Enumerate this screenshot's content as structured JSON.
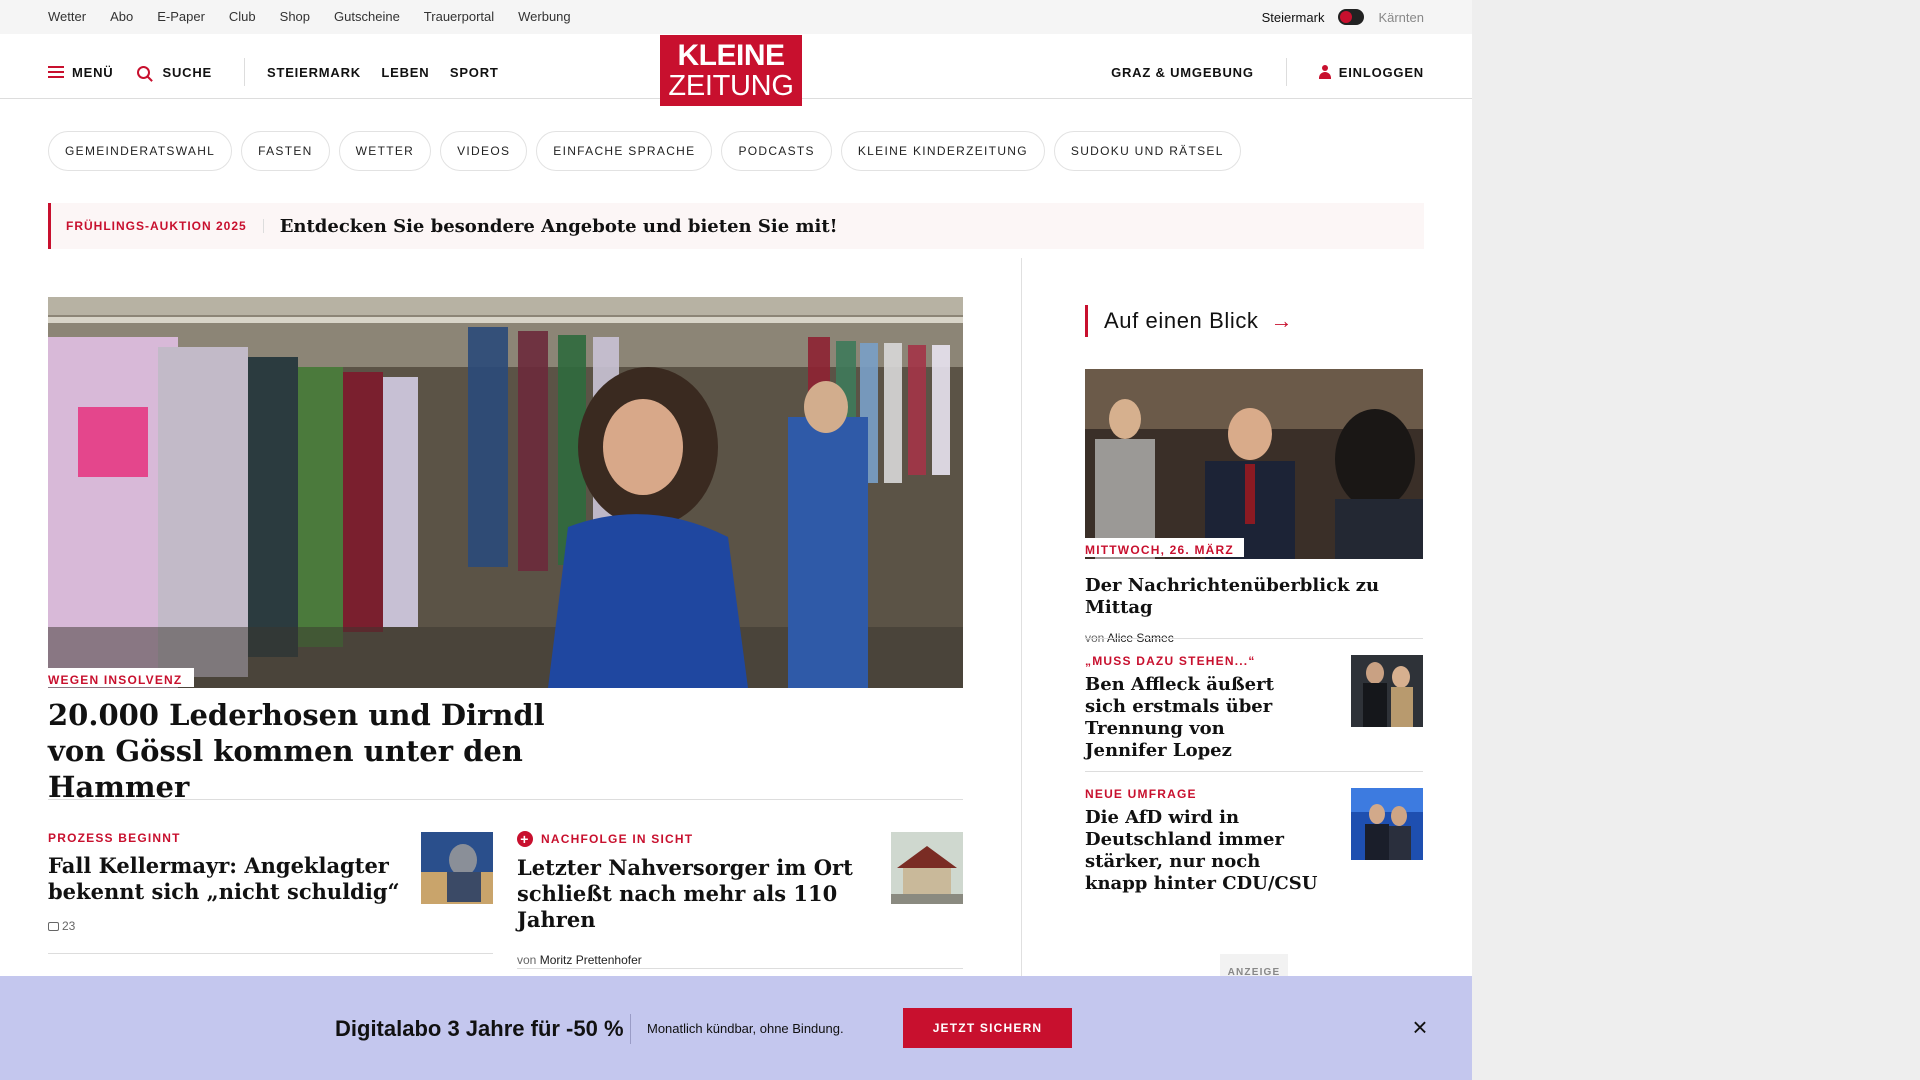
{
  "utility": {
    "links": [
      "Wetter",
      "Abo",
      "E-Paper",
      "Club",
      "Shop",
      "Gutscheine",
      "Trauerportal",
      "Werbung"
    ],
    "region_left": "Steiermark",
    "region_right": "Kärnten"
  },
  "header": {
    "menu_label": "MENÜ",
    "search_label": "SUCHE",
    "nav": [
      "STEIERMARK",
      "LEBEN",
      "SPORT"
    ],
    "logo_line1": "KLEINE",
    "logo_line2": "ZEITUNG",
    "local_label": "GRAZ & UMGEBUNG",
    "login_label": "EINLOGGEN"
  },
  "topics": [
    "GEMEINDERATSWAHL",
    "FASTEN",
    "WETTER",
    "VIDEOS",
    "EINFACHE SPRACHE",
    "PODCASTS",
    "KLEINE KINDERZEITUNG",
    "SUDOKU UND RÄTSEL"
  ],
  "promo": {
    "kicker": "FRÜHLINGS-AUKTION 2025",
    "text": "Entdecken Sie besondere Angebote und bieten Sie mit!"
  },
  "lead": {
    "kicker": "WEGEN INSOLVENZ",
    "title": "20.000 Lederhosen und Dirndl von Gössl kommen unter den Hammer"
  },
  "articles": [
    {
      "kicker": "PROZESS BEGINNT",
      "title": "Fall Kellermayr: Angeklagter bekennt sich „nicht schuldig“",
      "comments": "23"
    },
    {
      "kicker": "NACHFOLGE IN SICHT",
      "title": "Letzter Nahversorger im Ort schließt nach mehr als 110 Jahren",
      "author_prefix": "von",
      "author": "Moritz Prettenhofer"
    }
  ],
  "sidebar": {
    "heading": "Auf einen Blick",
    "feature": {
      "date": "MITTWOCH, 26. MÄRZ",
      "title": "Der Nachrichtenüberblick zu Mittag",
      "author_prefix": "von",
      "author": "Alice Samec"
    },
    "items": [
      {
        "kicker": "„MUSS DAZU STEHEN...“",
        "title": "Ben Affleck äußert sich erstmals über Trennung von Jennifer Lopez"
      },
      {
        "kicker": "NEUE UMFRAGE",
        "title": "Die AfD wird in Deutschland immer stärker, nur noch knapp hinter CDU/CSU"
      }
    ],
    "ad_label": "ANZEIGE"
  },
  "banner": {
    "headline": "Digitalabo 3 Jahre für -50 %",
    "sub": "Monatlich kündbar, ohne Bindung.",
    "cta": "JETZT SICHERN"
  },
  "colors": {
    "brand": "#c8102e",
    "banner_bg": "#c4c7ee"
  }
}
